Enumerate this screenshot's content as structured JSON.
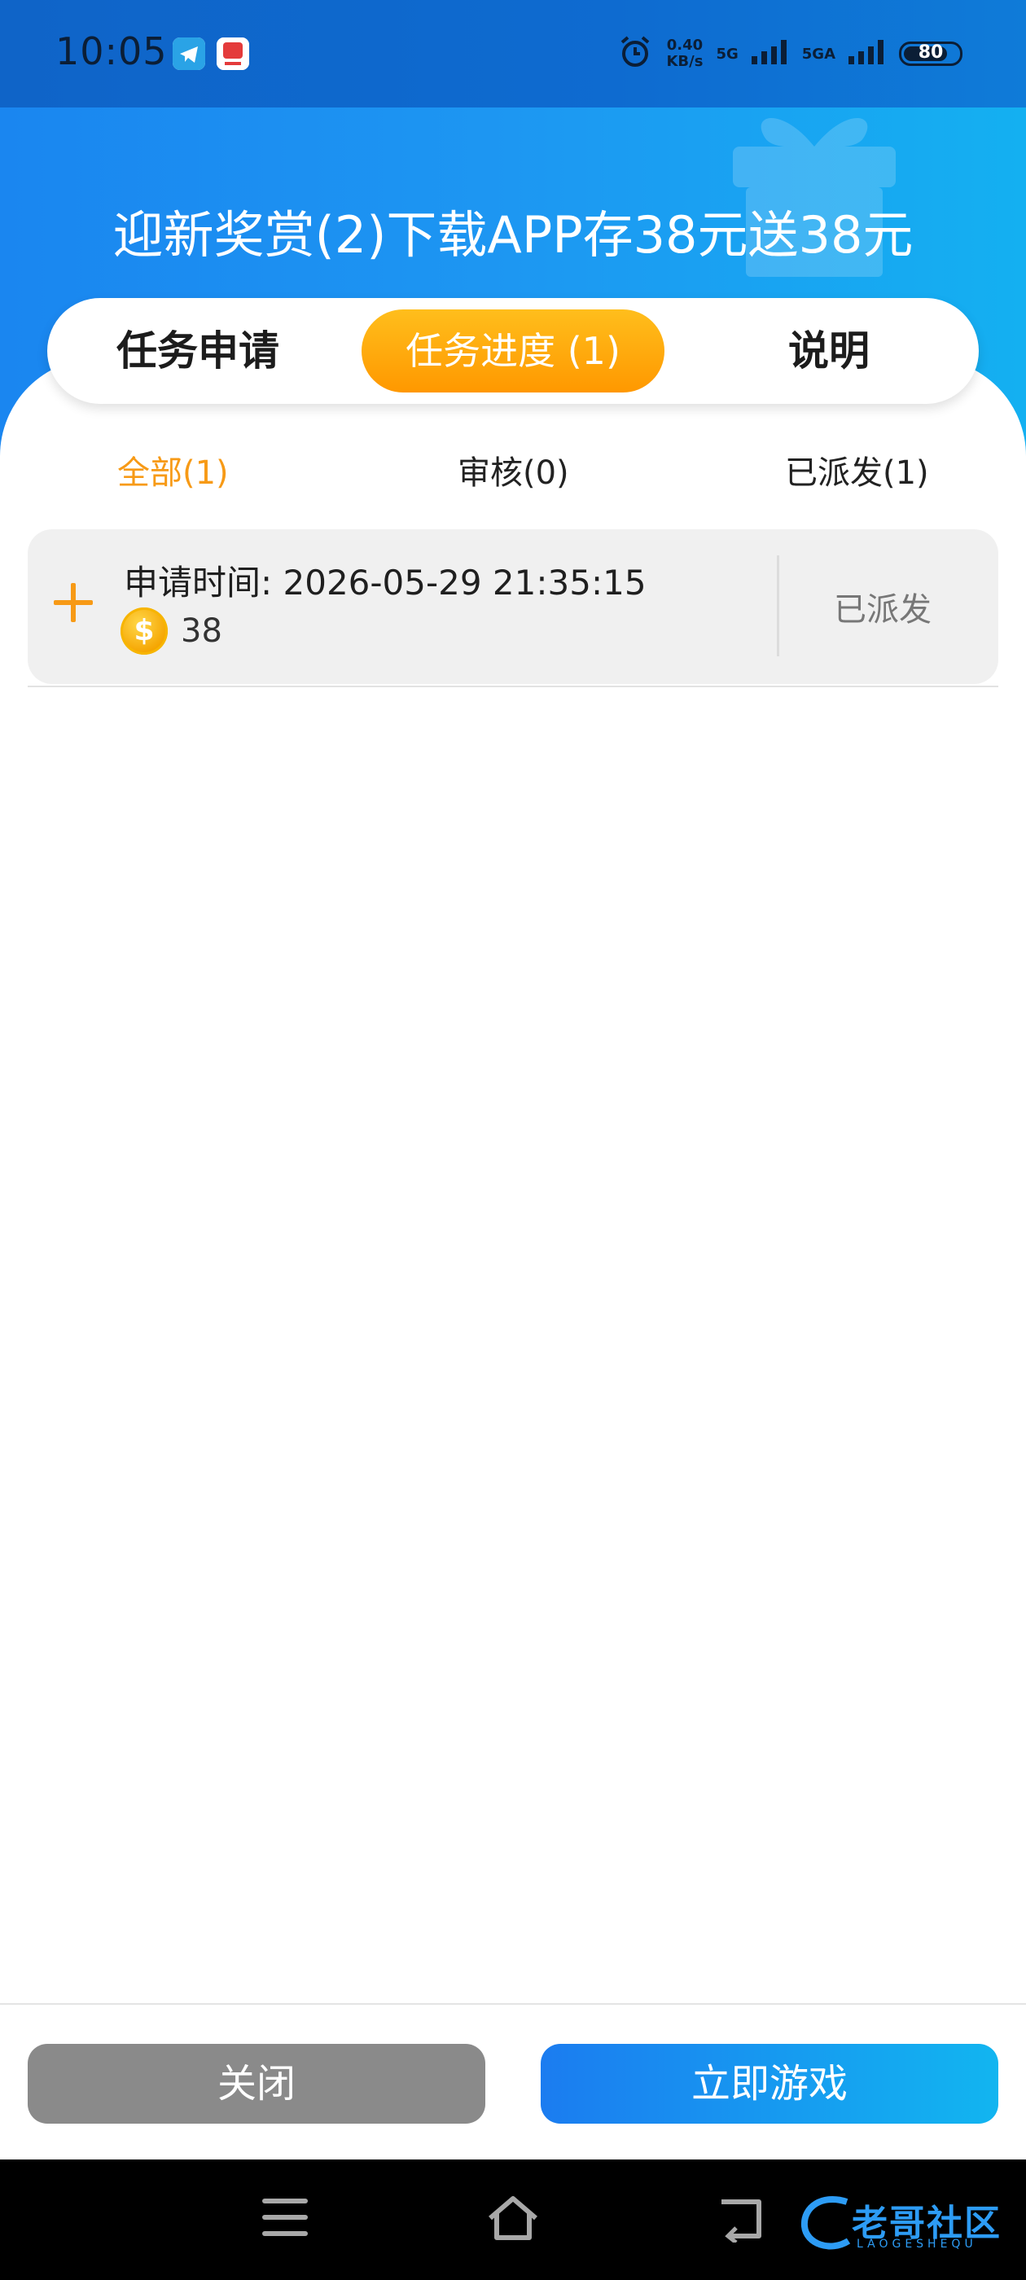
{
  "status_bar": {
    "time": "10:05",
    "speed_value": "0.40",
    "speed_unit": "KB/s",
    "network_1": "5G",
    "network_2": "5GA",
    "battery": "80",
    "battery_level": 0.8
  },
  "header": {
    "title": "迎新奖赏(2)下载APP存38元送38元"
  },
  "tabs": [
    {
      "label": "任务申请",
      "active": false
    },
    {
      "label": "任务进度 (1)",
      "active": true
    },
    {
      "label": "说明",
      "active": false
    }
  ],
  "filters": [
    {
      "label": "全部(1)",
      "active": true
    },
    {
      "label": "审核(0)",
      "active": false
    },
    {
      "label": "已派发(1)",
      "active": false
    }
  ],
  "records": [
    {
      "time_label": "申请时间: 2026-05-29 21:35:15",
      "amount": "38",
      "status": "已派发"
    }
  ],
  "buttons": {
    "close": "关闭",
    "play": "立即游戏"
  },
  "watermark": {
    "text": "老哥社区",
    "sub": "LAOGESHEQU"
  },
  "colors": {
    "accent_orange": "#f79a16",
    "header_blue": "#1d97f2",
    "button_gray": "#8a8a8a"
  }
}
